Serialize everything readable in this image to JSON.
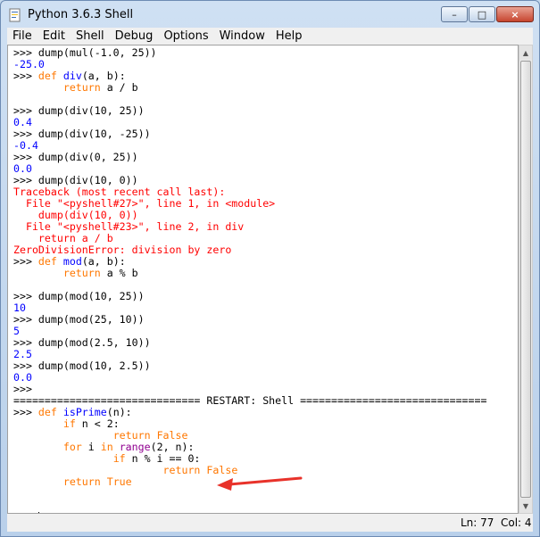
{
  "window": {
    "title": "Python 3.6.3 Shell",
    "buttons": {
      "minimize": "–",
      "maximize": "□",
      "close": "×"
    }
  },
  "menu": [
    "File",
    "Edit",
    "Shell",
    "Debug",
    "Options",
    "Window",
    "Help"
  ],
  "shell_lines": [
    {
      "parts": [
        {
          "t": ">>> dump(mul(-1.0, 25))",
          "c": ""
        }
      ]
    },
    {
      "parts": [
        {
          "t": "-25.0",
          "c": "out"
        }
      ]
    },
    {
      "parts": [
        {
          "t": ">>> ",
          "c": ""
        },
        {
          "t": "def",
          "c": "kw"
        },
        {
          "t": " ",
          "c": ""
        },
        {
          "t": "div",
          "c": "defn"
        },
        {
          "t": "(a, b):",
          "c": ""
        }
      ]
    },
    {
      "parts": [
        {
          "t": "        ",
          "c": ""
        },
        {
          "t": "return",
          "c": "kw"
        },
        {
          "t": " a / b",
          "c": ""
        }
      ]
    },
    {
      "parts": [
        {
          "t": "",
          "c": ""
        }
      ]
    },
    {
      "parts": [
        {
          "t": ">>> dump(div(10, 25))",
          "c": ""
        }
      ]
    },
    {
      "parts": [
        {
          "t": "0.4",
          "c": "out"
        }
      ]
    },
    {
      "parts": [
        {
          "t": ">>> dump(div(10, -25))",
          "c": ""
        }
      ]
    },
    {
      "parts": [
        {
          "t": "-0.4",
          "c": "out"
        }
      ]
    },
    {
      "parts": [
        {
          "t": ">>> dump(div(0, 25))",
          "c": ""
        }
      ]
    },
    {
      "parts": [
        {
          "t": "0.0",
          "c": "out"
        }
      ]
    },
    {
      "parts": [
        {
          "t": ">>> dump(div(10, 0))",
          "c": ""
        }
      ]
    },
    {
      "parts": [
        {
          "t": "Traceback (most recent call last):",
          "c": "err"
        }
      ]
    },
    {
      "parts": [
        {
          "t": "  File \"<pyshell#27>\", line 1, in <module>",
          "c": "err"
        }
      ]
    },
    {
      "parts": [
        {
          "t": "    dump(div(10, 0))",
          "c": "err"
        }
      ]
    },
    {
      "parts": [
        {
          "t": "  File \"<pyshell#23>\", line 2, in div",
          "c": "err"
        }
      ]
    },
    {
      "parts": [
        {
          "t": "    return a / b",
          "c": "err"
        }
      ]
    },
    {
      "parts": [
        {
          "t": "ZeroDivisionError: division by zero",
          "c": "err"
        }
      ]
    },
    {
      "parts": [
        {
          "t": ">>> ",
          "c": ""
        },
        {
          "t": "def",
          "c": "kw"
        },
        {
          "t": " ",
          "c": ""
        },
        {
          "t": "mod",
          "c": "defn"
        },
        {
          "t": "(a, b):",
          "c": ""
        }
      ]
    },
    {
      "parts": [
        {
          "t": "        ",
          "c": ""
        },
        {
          "t": "return",
          "c": "kw"
        },
        {
          "t": " a % b",
          "c": ""
        }
      ]
    },
    {
      "parts": [
        {
          "t": "",
          "c": ""
        }
      ]
    },
    {
      "parts": [
        {
          "t": ">>> dump(mod(10, 25))",
          "c": ""
        }
      ]
    },
    {
      "parts": [
        {
          "t": "10",
          "c": "out"
        }
      ]
    },
    {
      "parts": [
        {
          "t": ">>> dump(mod(25, 10))",
          "c": ""
        }
      ]
    },
    {
      "parts": [
        {
          "t": "5",
          "c": "out"
        }
      ]
    },
    {
      "parts": [
        {
          "t": ">>> dump(mod(2.5, 10))",
          "c": ""
        }
      ]
    },
    {
      "parts": [
        {
          "t": "2.5",
          "c": "out"
        }
      ]
    },
    {
      "parts": [
        {
          "t": ">>> dump(mod(10, 2.5))",
          "c": ""
        }
      ]
    },
    {
      "parts": [
        {
          "t": "0.0",
          "c": "out"
        }
      ]
    },
    {
      "parts": [
        {
          "t": ">>>",
          "c": ""
        }
      ]
    },
    {
      "parts": [
        {
          "t": "============================== RESTART: Shell ==============================",
          "c": ""
        }
      ]
    },
    {
      "parts": [
        {
          "t": ">>> ",
          "c": ""
        },
        {
          "t": "def",
          "c": "kw"
        },
        {
          "t": " ",
          "c": ""
        },
        {
          "t": "isPrime",
          "c": "defn"
        },
        {
          "t": "(n):",
          "c": ""
        }
      ]
    },
    {
      "parts": [
        {
          "t": "        ",
          "c": ""
        },
        {
          "t": "if",
          "c": "kw"
        },
        {
          "t": " n < 2:",
          "c": ""
        }
      ]
    },
    {
      "parts": [
        {
          "t": "                ",
          "c": ""
        },
        {
          "t": "return",
          "c": "kw"
        },
        {
          "t": " ",
          "c": ""
        },
        {
          "t": "False",
          "c": "kw"
        }
      ]
    },
    {
      "parts": [
        {
          "t": "        ",
          "c": ""
        },
        {
          "t": "for",
          "c": "kw"
        },
        {
          "t": " i ",
          "c": ""
        },
        {
          "t": "in",
          "c": "kw"
        },
        {
          "t": " ",
          "c": ""
        },
        {
          "t": "range",
          "c": "bi"
        },
        {
          "t": "(2, n):",
          "c": ""
        }
      ]
    },
    {
      "parts": [
        {
          "t": "                ",
          "c": ""
        },
        {
          "t": "if",
          "c": "kw"
        },
        {
          "t": " n % i == 0:",
          "c": ""
        }
      ]
    },
    {
      "parts": [
        {
          "t": "                        ",
          "c": ""
        },
        {
          "t": "return",
          "c": "kw"
        },
        {
          "t": " ",
          "c": ""
        },
        {
          "t": "False",
          "c": "kw"
        }
      ]
    },
    {
      "parts": [
        {
          "t": "        ",
          "c": ""
        },
        {
          "t": "return",
          "c": "kw"
        },
        {
          "t": " ",
          "c": ""
        },
        {
          "t": "True",
          "c": "kw"
        }
      ]
    },
    {
      "parts": [
        {
          "t": "",
          "c": ""
        }
      ]
    },
    {
      "parts": [
        {
          "t": "",
          "c": ""
        }
      ]
    },
    {
      "parts": [
        {
          "t": ">>> ",
          "c": ""
        }
      ],
      "cursor": true
    }
  ],
  "status": {
    "line": "Ln: 77",
    "col": "Col: 4"
  },
  "colors": {
    "keyword": "#ff7700",
    "definition": "#0000ff",
    "output": "#0000ff",
    "error": "#ff0000",
    "arrow": "#e8322a"
  },
  "icons": {
    "app": "python-shell-icon",
    "annotation": "red-arrow-icon"
  }
}
